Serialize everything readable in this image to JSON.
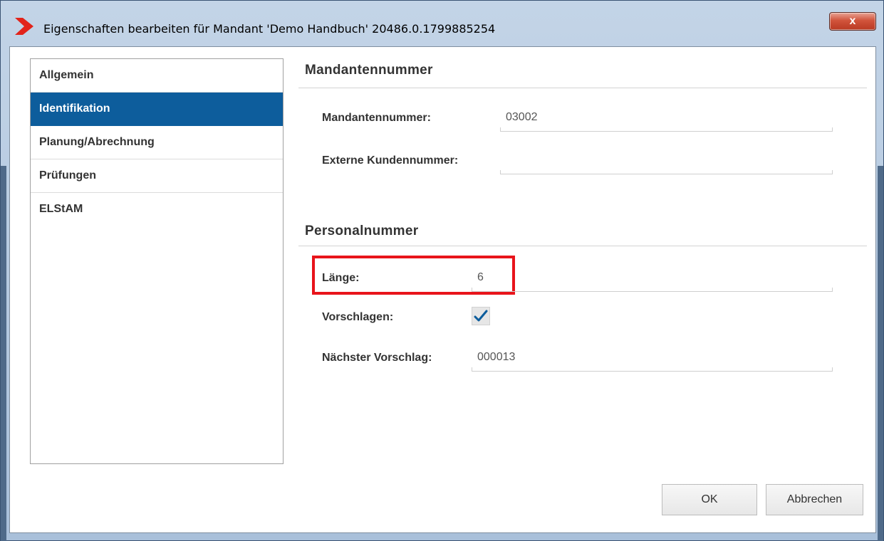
{
  "window": {
    "title": "Eigenschaften bearbeiten für Mandant 'Demo Handbuch' 20486.0.1799885254",
    "close_label": "x"
  },
  "sidebar": {
    "items": [
      {
        "label": "Allgemein"
      },
      {
        "label": "Identifikation",
        "selected": true
      },
      {
        "label": "Planung/Abrechnung"
      },
      {
        "label": "Prüfungen"
      },
      {
        "label": "ELStAM"
      }
    ]
  },
  "sections": {
    "mandantennummer": {
      "title": "Mandantennummer",
      "fields": {
        "mandantennummer": {
          "label": "Mandantennummer:",
          "value": "03002"
        },
        "externe_kundennummer": {
          "label": "Externe Kundennummer:",
          "value": ""
        }
      }
    },
    "personalnummer": {
      "title": "Personalnummer",
      "fields": {
        "laenge": {
          "label": "Länge:",
          "value": "6"
        },
        "vorschlagen": {
          "label": "Vorschlagen:",
          "checked": true
        },
        "naechster_vorschlag": {
          "label": "Nächster Vorschlag:",
          "value": "000013"
        }
      }
    }
  },
  "buttons": {
    "ok": "OK",
    "cancel": "Abbrechen"
  },
  "colors": {
    "accent": "#0d5d9c",
    "highlight": "#e8141b",
    "logo": "#e2231a"
  },
  "icons": {
    "logo": "red-chevron-logo",
    "close": "close-icon",
    "check": "checkmark-icon"
  }
}
